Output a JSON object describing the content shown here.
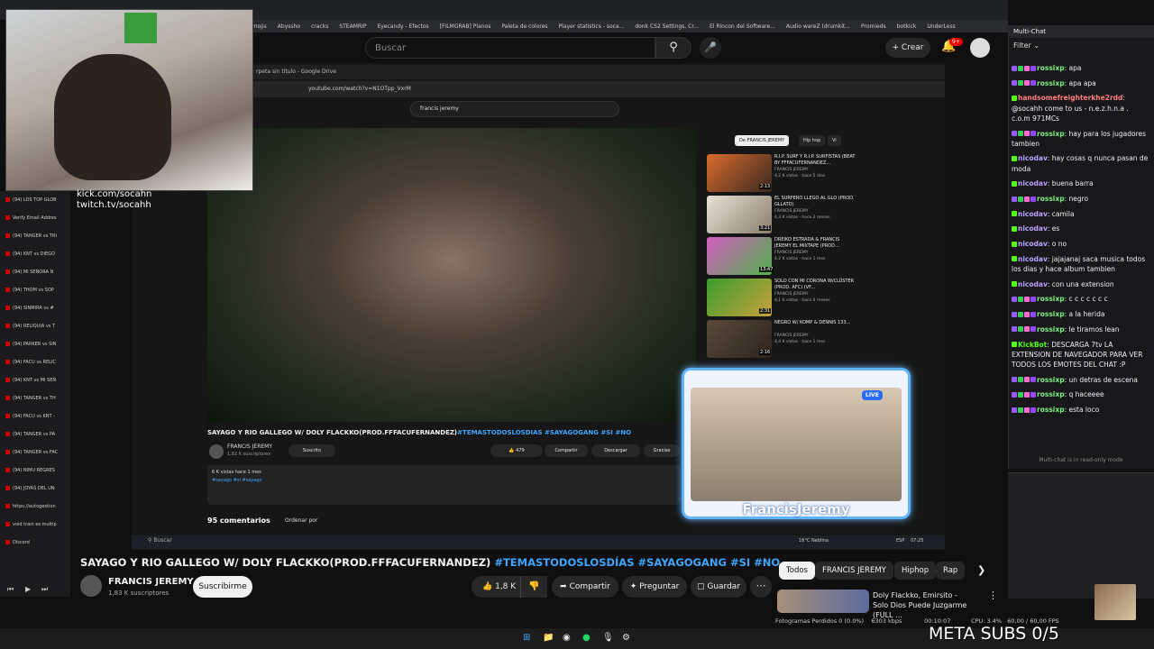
{
  "browser": {
    "bookmarks": [
      "Emojis",
      "Abyssho",
      "cracks",
      "STEAMRIP",
      "Eyecandy - Efectos",
      "[FILMGRAB] Planos",
      "Paleta de colores",
      "Player statistics - soca...",
      "donk CS2 Settings, Cr...",
      "El Rincon del Software...",
      "Audio wareZ (drumkit...",
      "Promieds",
      "botkick",
      "UnderLess"
    ]
  },
  "yt_header": {
    "search_placeholder": "Buscar",
    "create_label": "Crear",
    "notif_badge": "9+"
  },
  "left_tabs": [
    "(94) LOS TOP GLOB",
    "Verify Email Addres",
    "(94) TANGER vs TRI",
    "(94) KNT vs DIEGO",
    "(94) MI SEÑORA N",
    "(94) THOM vs SOP",
    "(94) SINMIRA vs #",
    "(94) RELIQUIA vs T",
    "(94) PARKER vs SIN",
    "(94) FACU vs RELIC",
    "(94) KNT vs MI SEÑ",
    "(94) TANGER vs TH",
    "(94) FACU vs KNT -",
    "(94) TANGER vs PA",
    "(94) TANGER vs FAC",
    "(94) NIMU REGRES",
    "(94) JOYAS DEL UN",
    "https://autogestion",
    "void train es multip",
    "Discord"
  ],
  "overlay": {
    "kick_lines": [
      "kick.com/socahn",
      "twitch.tv/socahh"
    ]
  },
  "inner": {
    "tab_title": "rpeta sin título - Google Drive",
    "url": "youtube.com/watch?v=N1OTpp_VxrM",
    "search_value": "francis jeremy",
    "title_main": "SAYAGO Y RIO GALLEGO W/ DOLY FLACKKO(PROD.FFFACUFERNANDEZ)",
    "title_tags": "#TEMASTODOSLOSDIAS #SAYAGOGANG #SI #NO",
    "channel": "FRANCIS JEREMY",
    "subs": "1,82 K suscriptores",
    "subscribed": "Suscrito",
    "likes": "479",
    "share": "Compartir",
    "download": "Descargar",
    "thanks": "Gracias",
    "views": "6 K vistas  hace 1 mes",
    "desc_tags": "#sayago #si #sayago",
    "comments": "95 comentarios",
    "order": "Ordenar por",
    "chips": [
      "De FRANCIS JEREMY",
      "Hip hop",
      "Vi"
    ],
    "related": [
      {
        "title": "R.I.P. SURF Y R.I.P. SURFISTAS (BEAT BY FFFACUFERNANDEZ...",
        "channel": "FRANCIS JEREMY",
        "meta": "4,2 K vistas · hace 5 días",
        "dur": "2:13"
      },
      {
        "title": "EL SURFERO LLEGO AL GLO (PROD. GLLATO)",
        "channel": "FRANCIS JEREMY",
        "meta": "4,3 K vistas · hace 2 meses",
        "dur": "3:21"
      },
      {
        "title": "DREIKO ESTRADA & FRANCIS JEREMY EL MIXTAPE (PROD...",
        "channel": "FRANCIS JEREMY",
        "meta": "4,2 K vistas · hace 1 mes",
        "dur": "13:47"
      },
      {
        "title": "SOLO CON MI CORONA W/CLÜSTER (PROD. AFC) (VF...",
        "channel": "FRANCIS JEREMY",
        "meta": "4,1 K vistas · hace 4 meses",
        "dur": "2:31"
      },
      {
        "title": "NEGRO W/ KOMP & DENNIS 133...",
        "channel": "FRANCIS JEREMY",
        "meta": "4,4 K vistas · hace 1 mes",
        "dur": "2:16"
      }
    ],
    "taskbar_search": "Buscar",
    "weather": "16°C Neblina",
    "lang": "ESP",
    "time": "07:25"
  },
  "fj": {
    "live": "LIVE",
    "name": "FrancisJeremy"
  },
  "main": {
    "title": "SAYAGO Y RIO GALLEGO W/ DOLY FLACKKO(PROD.FFFACUFERNANDEZ)",
    "tags": "#TEMASTODOSLOSDÍAS #SAYAGOGANG #SI #NO",
    "channel": "FRANCIS JEREMY",
    "subs": "1,83 K suscriptores",
    "subscribe": "Suscribirme",
    "likes": "1,8 K",
    "share": "Compartir",
    "ask": "Preguntar",
    "save": "Guardar",
    "chips": [
      "Todos",
      "FRANCIS JEREMY",
      "Hiphop",
      "Rap"
    ],
    "suggested_title": "Doly Flackko, Emirsito - Solo Dios Puede Juzgarme (FULL ..."
  },
  "chat": {
    "header": "Multi-Chat",
    "filter": "Filter",
    "readonly": "Multi-chat is in read-only mode",
    "messages": [
      {
        "user": "rossixp",
        "color": "#7ef081",
        "badges": [
          "#9b59ff",
          "#2fd15b",
          "#ff6ad5",
          "#9147ff"
        ],
        "text": "apa"
      },
      {
        "user": "rossixp",
        "color": "#7ef081",
        "badges": [
          "#9b59ff",
          "#2fd15b",
          "#ff6ad5",
          "#9147ff"
        ],
        "text": "apa apa"
      },
      {
        "user": "handsomefreighterkhe2rdd",
        "color": "#ff7f7f",
        "badges": [
          "#53fc18"
        ],
        "text": "@socahh come to us - n.e.z.h.n.a . c.o.m 971MCs"
      },
      {
        "user": "rossixp",
        "color": "#7ef081",
        "badges": [
          "#9b59ff",
          "#2fd15b",
          "#ff6ad5",
          "#9147ff"
        ],
        "text": "hay para los jugadores tambien"
      },
      {
        "user": "nicodav",
        "color": "#b9a3ff",
        "badges": [
          "#53fc18"
        ],
        "text": "hay cosas q nunca pasan de moda"
      },
      {
        "user": "nicodav",
        "color": "#b9a3ff",
        "badges": [
          "#53fc18"
        ],
        "text": "buena barra"
      },
      {
        "user": "rossixp",
        "color": "#7ef081",
        "badges": [
          "#9b59ff",
          "#2fd15b",
          "#ff6ad5",
          "#9147ff"
        ],
        "text": "negro"
      },
      {
        "user": "nicodav",
        "color": "#b9a3ff",
        "badges": [
          "#53fc18"
        ],
        "text": "camila"
      },
      {
        "user": "nicodav",
        "color": "#b9a3ff",
        "badges": [
          "#53fc18"
        ],
        "text": "es"
      },
      {
        "user": "nicodav",
        "color": "#b9a3ff",
        "badges": [
          "#53fc18"
        ],
        "text": "o no"
      },
      {
        "user": "nicodav",
        "color": "#b9a3ff",
        "badges": [
          "#53fc18"
        ],
        "text": "jajajanaj saca musica todos los dias y hace album tambien"
      },
      {
        "user": "nicodav",
        "color": "#b9a3ff",
        "badges": [
          "#53fc18"
        ],
        "text": "con una extension"
      },
      {
        "user": "rossixp",
        "color": "#7ef081",
        "badges": [
          "#9b59ff",
          "#2fd15b",
          "#ff6ad5",
          "#9147ff"
        ],
        "text": "c c c c c c c"
      },
      {
        "user": "rossixp",
        "color": "#7ef081",
        "badges": [
          "#9b59ff",
          "#2fd15b",
          "#ff6ad5",
          "#9147ff"
        ],
        "text": "a la herida"
      },
      {
        "user": "rossixp",
        "color": "#7ef081",
        "badges": [
          "#9b59ff",
          "#2fd15b",
          "#ff6ad5",
          "#9147ff"
        ],
        "text": "le tiramos lean"
      },
      {
        "user": "KickBot",
        "color": "#53fc18",
        "badges": [
          "#53fc18"
        ],
        "text": "DESCARGA 7tv LA EXTENSION DE NAVEGADOR PARA VER TODOS LOS EMOTES DEL CHAT :P"
      },
      {
        "user": "rossixp",
        "color": "#7ef081",
        "badges": [
          "#9b59ff",
          "#2fd15b",
          "#ff6ad5",
          "#9147ff"
        ],
        "text": "un detras de escena"
      },
      {
        "user": "rossixp",
        "color": "#7ef081",
        "badges": [
          "#9b59ff",
          "#2fd15b",
          "#ff6ad5",
          "#9147ff"
        ],
        "text": "q haceeee"
      },
      {
        "user": "rossixp",
        "color": "#7ef081",
        "badges": [
          "#9b59ff",
          "#2fd15b",
          "#ff6ad5",
          "#9147ff"
        ],
        "text": "esta loco"
      }
    ]
  },
  "status": {
    "dropped": "Fotogramas Perdidos 0 (0.0%)",
    "bitrate": "6303 kbps",
    "rec": "00:10:07",
    "cpu": "CPU: 3.4%",
    "fps": "60,00 / 60,00 FPS"
  },
  "meta_subs": "META SUBS 0/5"
}
